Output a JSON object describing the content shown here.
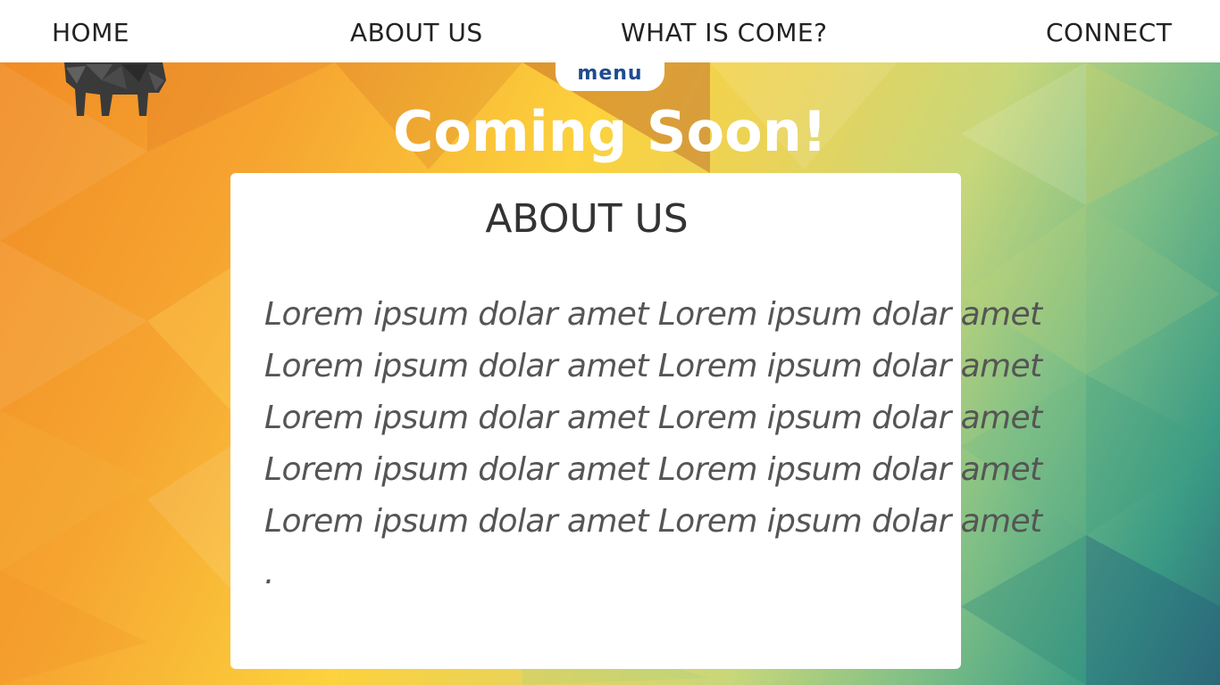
{
  "nav": {
    "home": "HOME",
    "about": "ABOUT US",
    "what": "WHAT IS COME?",
    "connect": "CONNECT",
    "menu": "menu"
  },
  "logo": {
    "icon": "elephant-icon"
  },
  "hero": {
    "title": "Coming Soon!"
  },
  "about_card": {
    "title": "ABOUT US",
    "lines": [
      "Lorem ipsum dolar amet Lorem ipsum dolar amet",
      "Lorem ipsum dolar amet Lorem ipsum dolar amet",
      "Lorem ipsum dolar amet Lorem ipsum dolar amet",
      "Lorem ipsum dolar amet Lorem ipsum dolar amet",
      "Lorem ipsum dolar amet Lorem ipsum dolar amet",
      "."
    ]
  },
  "colors": {
    "nav_text": "#222222",
    "menu_text": "#1e4b8f",
    "card_bg": "#ffffff",
    "title_text": "#333333",
    "body_text": "#555555"
  }
}
